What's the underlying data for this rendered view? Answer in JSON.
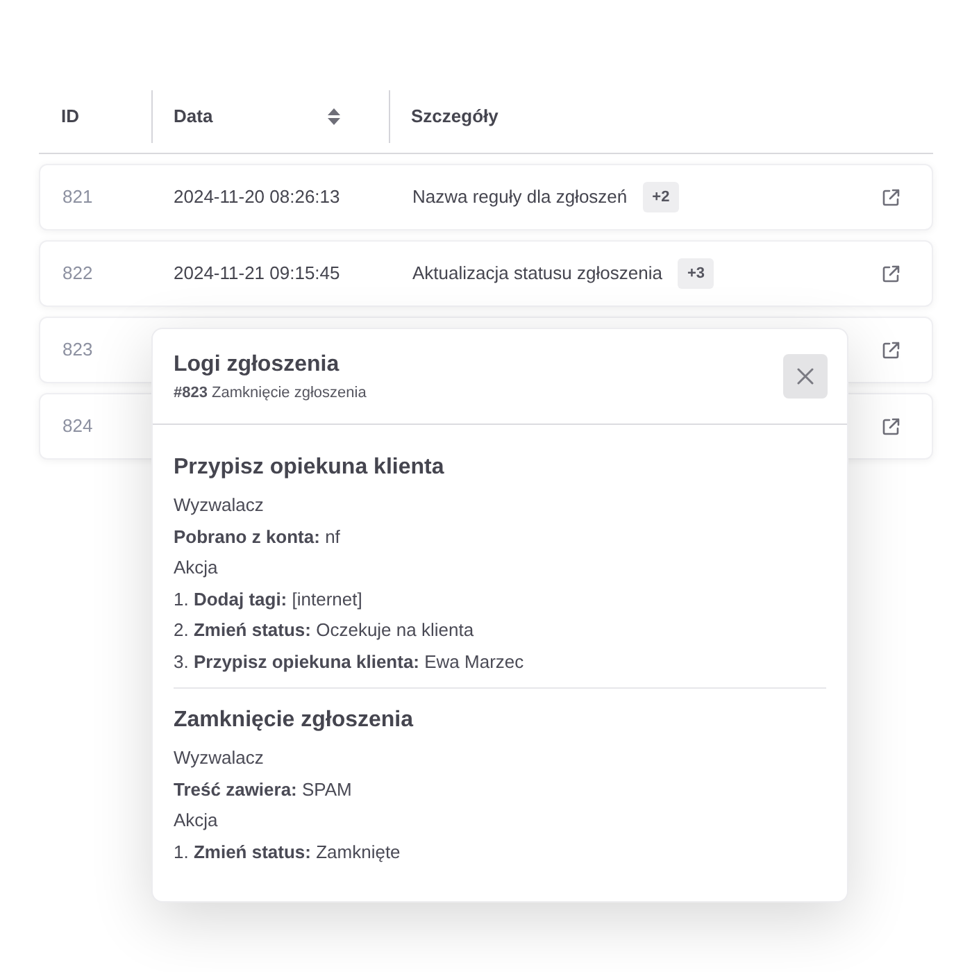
{
  "table": {
    "columns": [
      {
        "label": "ID",
        "sortable": false
      },
      {
        "label": "Data",
        "sortable": true
      },
      {
        "label": "Szczegóły",
        "sortable": false
      }
    ],
    "rows": [
      {
        "id": "821",
        "date": "2024-11-20 08:26:13",
        "details": "Nazwa reguły dla zgłoszeń",
        "badge": "+2"
      },
      {
        "id": "822",
        "date": "2024-11-21 09:15:45",
        "details": "Aktualizacja statusu zgłoszenia",
        "badge": "+3"
      },
      {
        "id": "823"
      },
      {
        "id": "824"
      }
    ]
  },
  "modal": {
    "title": "Logi zgłoszenia",
    "subtitle": "**#823** Zamknięcie zgłoszenia",
    "sections": [
      {
        "title": "Przypisz opiekuna klienta",
        "trigger_label": "Wyzwalacz",
        "conditions": [
          "**Pobrano z konta:** nf"
        ],
        "action_label": "Akcja",
        "actions": [
          "1. **Dodaj tagi:** [internet]",
          "2. **Zmień status:** Oczekuje na klienta",
          "3. **Przypisz opiekuna klienta:** Ewa Marzec"
        ]
      },
      {
        "title": "Zamknięcie zgłoszenia",
        "trigger_label": "Wyzwalacz",
        "conditions": [
          "**Treść zawiera:** SPAM"
        ],
        "action_label": "Akcja",
        "actions": [
          "1. **Zmień status:** Zamknięte"
        ]
      }
    ]
  }
}
